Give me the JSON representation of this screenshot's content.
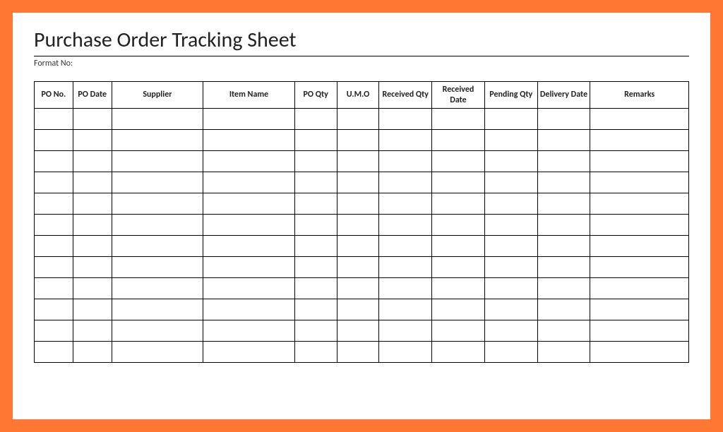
{
  "title": "Purchase Order Tracking Sheet",
  "format_label": "Format No:",
  "format_value": "",
  "columns": [
    "PO No.",
    "PO Date",
    "Supplier",
    "Item Name",
    "PO Qty",
    "U.M.O",
    "Received Qty",
    "Received Date",
    "Pending Qty",
    "Delivery Date",
    "Remarks"
  ],
  "rows": [
    [
      "",
      "",
      "",
      "",
      "",
      "",
      "",
      "",
      "",
      "",
      ""
    ],
    [
      "",
      "",
      "",
      "",
      "",
      "",
      "",
      "",
      "",
      "",
      ""
    ],
    [
      "",
      "",
      "",
      "",
      "",
      "",
      "",
      "",
      "",
      "",
      ""
    ],
    [
      "",
      "",
      "",
      "",
      "",
      "",
      "",
      "",
      "",
      "",
      ""
    ],
    [
      "",
      "",
      "",
      "",
      "",
      "",
      "",
      "",
      "",
      "",
      ""
    ],
    [
      "",
      "",
      "",
      "",
      "",
      "",
      "",
      "",
      "",
      "",
      ""
    ],
    [
      "",
      "",
      "",
      "",
      "",
      "",
      "",
      "",
      "",
      "",
      ""
    ],
    [
      "",
      "",
      "",
      "",
      "",
      "",
      "",
      "",
      "",
      "",
      ""
    ],
    [
      "",
      "",
      "",
      "",
      "",
      "",
      "",
      "",
      "",
      "",
      ""
    ],
    [
      "",
      "",
      "",
      "",
      "",
      "",
      "",
      "",
      "",
      "",
      ""
    ],
    [
      "",
      "",
      "",
      "",
      "",
      "",
      "",
      "",
      "",
      "",
      ""
    ],
    [
      "",
      "",
      "",
      "",
      "",
      "",
      "",
      "",
      "",
      "",
      ""
    ]
  ]
}
